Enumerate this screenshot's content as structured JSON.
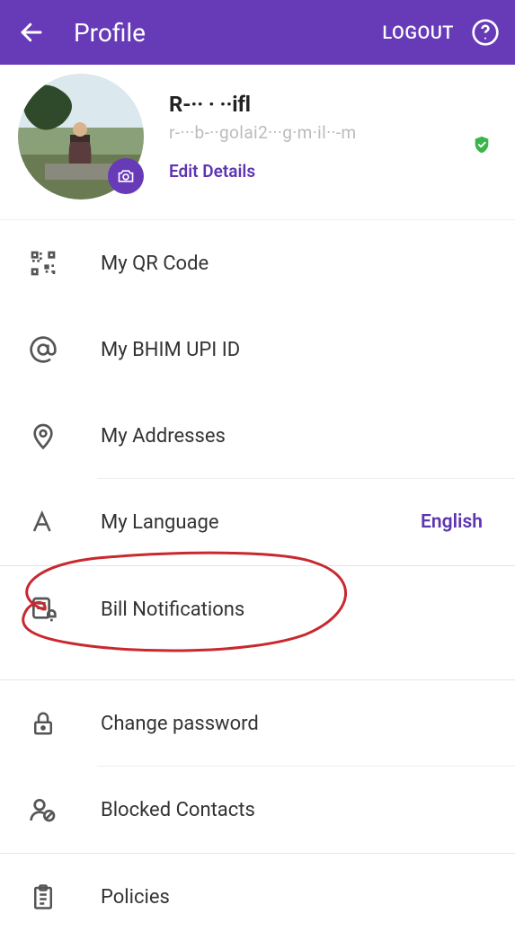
{
  "header": {
    "title": "Profile",
    "logout": "LOGOUT"
  },
  "profile": {
    "name_glyph": "R‐··  ·    ··ifl",
    "email_glyph": "r‐···b‐··golai2···g·m·il··‐m",
    "edit": "Edit Details"
  },
  "menu": {
    "qr": "My QR Code",
    "upi": "My BHIM UPI ID",
    "addresses": "My Addresses",
    "language": "My Language",
    "language_value": "English",
    "bill": "Bill Notifications",
    "password": "Change password",
    "blocked": "Blocked Contacts",
    "policies": "Policies"
  }
}
